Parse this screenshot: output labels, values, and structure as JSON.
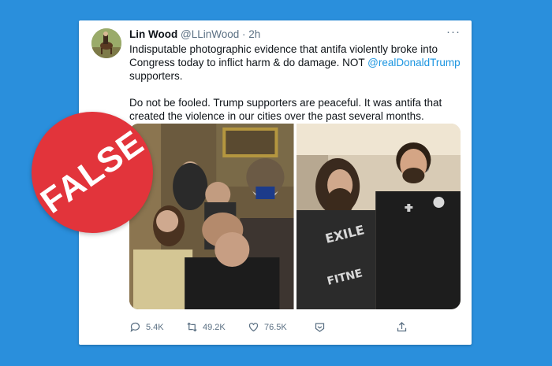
{
  "tweet": {
    "author_name": "Lin Wood",
    "author_handle": "@LLinWood",
    "separator": "·",
    "time": "2h",
    "more_icon": "···",
    "text_line1_a": "Indisputable photographic evidence that antifa violently broke into Congress today to inflict harm & do damage. NOT ",
    "mention": "@realDonaldTrump",
    "text_line1_b": " supporters.",
    "text_para2": "Do not be fooled. Trump supporters are peaceful. It was antifa that created the violence in our cities over the past several months."
  },
  "media": {
    "left_photo": "crowd-photo",
    "right_photo": "two-men-photo",
    "shirt_text_1": "EXILE",
    "shirt_text_2": "FITNE"
  },
  "actions": {
    "reply_count": "5.4K",
    "retweet_count": "49.2K",
    "like_count": "76.5K"
  },
  "stamp": {
    "label": "FALSE",
    "color": "#e2343b"
  },
  "colors": {
    "background": "#2a8fdc",
    "link": "#1b95e0"
  }
}
